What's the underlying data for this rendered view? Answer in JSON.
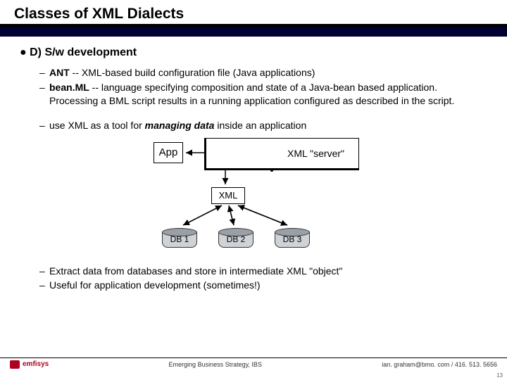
{
  "title": "Classes of XML Dialects",
  "section": "D) S/w development",
  "items1": {
    "ant_label": "ANT",
    "ant_rest": " -- XML-based build configuration file (Java applications)",
    "bean_label": "bean.ML",
    "bean_rest": " -- language specifying composition and state of a Java-bean based application.  Processing a BML script results in a running application configured as described in the script."
  },
  "item_mid_pre": "use XML as a tool for ",
  "item_mid_em": "managing data",
  "item_mid_post": " inside an application",
  "diagram": {
    "app": "App",
    "server": "XML  \"server\"",
    "xml": "XML",
    "db1": "DB 1",
    "db2": "DB 2",
    "db3": "DB 3"
  },
  "items2": {
    "a": "Extract data from databases and store in intermediate XML \"object\"",
    "b": "Useful for application development (sometimes!)"
  },
  "footer": {
    "logo": "emfisys",
    "center": "Emerging Business Strategy, IBS",
    "right": "ian. graham@bmo. com / 416. 513. 5656",
    "page": "13"
  }
}
